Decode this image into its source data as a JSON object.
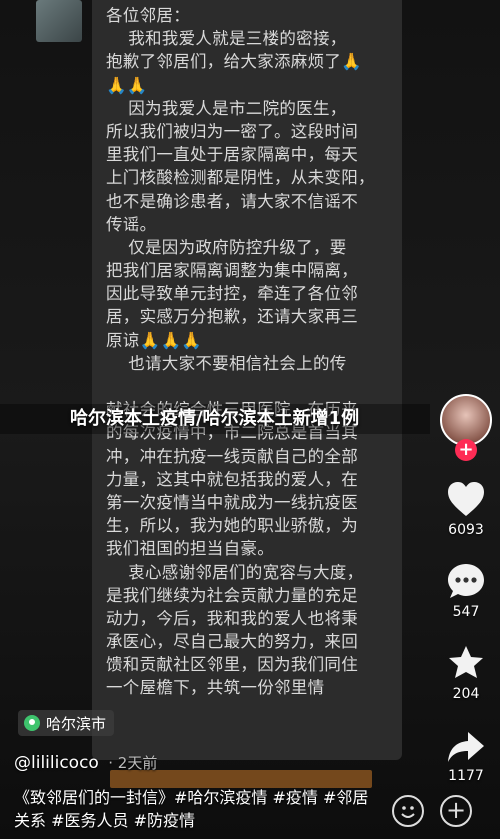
{
  "letter_lines": [
    "各位邻居：",
    "    我和我爱人就是三楼的密接，",
    "抱歉了邻居们，给大家添麻烦了🙏",
    "🙏🙏",
    "    因为我爱人是市二院的医生，",
    "所以我们被归为一密了。这段时间",
    "里我们一直处于居家隔离中，每天",
    "上门核酸检测都是阴性，从未变阳，",
    "也不是确诊患者，请大家不信谣不",
    "传谣。",
    "    仅是因为政府防控升级了，要",
    "把我们居家隔离调整为集中隔离，",
    "因此导致单元封控，牵连了各位邻",
    "居，实感万分抱歉，还请大家再三",
    "原谅🙏🙏🙏",
    "    也请大家不要相信社会上的传",
    "",
    "献社会的综合性三甲医院，在历来",
    "的每次疫情中，市二院总是首当其",
    "冲，冲在抗疫一线贡献自己的全部",
    "力量，这其中就包括我的爱人，在",
    "第一次疫情当中就成为一线抗疫医",
    "生，所以，我为她的职业骄傲，为",
    "我们祖国的担当自豪。",
    "    衷心感谢邻居们的宽容与大度，",
    "是我们继续为社会贡献力量的充足",
    "动力，今后，我和我的爱人也将秉",
    "承医心，尽自己最大的努力，来回",
    "馈和贡献社区邻里，因为我们同住",
    "一个屋檐下，共筑一份邻里情"
  ],
  "overlay_title": "哈尔滨本土疫情/哈尔滨本土新增1例",
  "actions": {
    "likes": "6093",
    "comments": "547",
    "favorites": "204",
    "shares": "1177",
    "follow_symbol": "+"
  },
  "location": "哈尔滨市",
  "author": "@lililicoco",
  "post_time": "· 2天前",
  "caption": "《致邻居们的一封信》#哈尔滨疫情 #疫情 #邻居关系 #医务人员 #防疫情",
  "colors": {
    "accent": "#fe2c55",
    "location_pin": "#3ec46d"
  }
}
